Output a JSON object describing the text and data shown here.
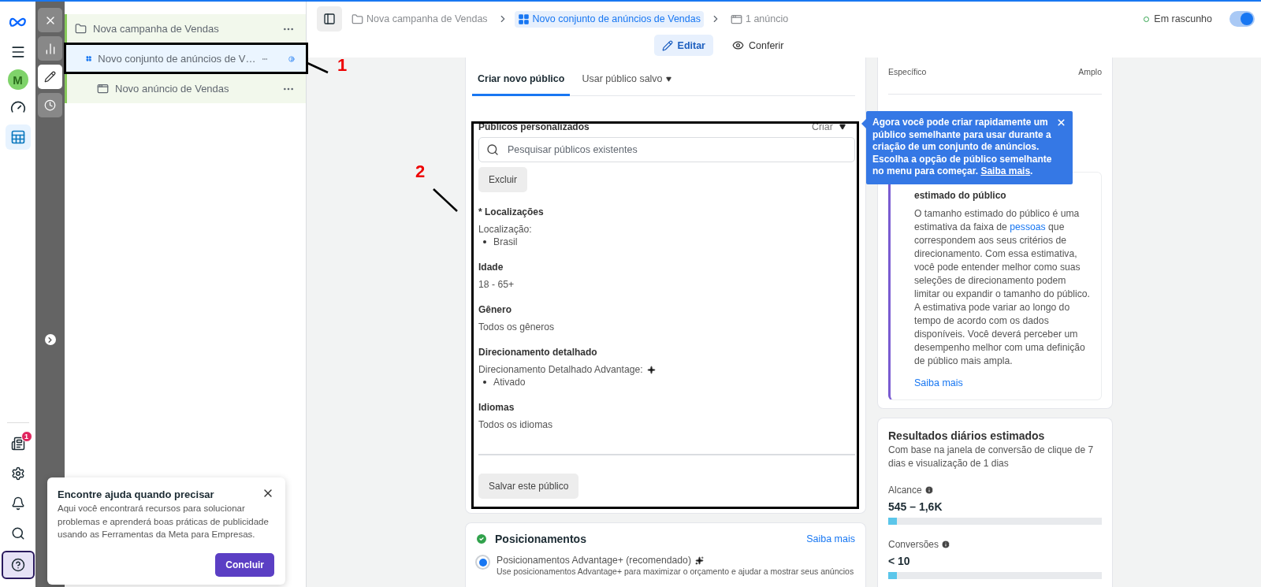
{
  "rail": {
    "avatar": "M",
    "items": [
      {
        "kind": "gauge",
        "selected": false
      },
      {
        "kind": "table",
        "selected": true
      }
    ],
    "notification_count": "1",
    "bottom": [
      {
        "kind": "news",
        "selected": false
      },
      {
        "kind": "settings",
        "selected": false
      },
      {
        "kind": "bell",
        "selected": false
      },
      {
        "kind": "search",
        "selected": false
      },
      {
        "kind": "help",
        "selected": true
      }
    ]
  },
  "tool_strip": [
    {
      "kind": "close",
      "selected": false
    },
    {
      "kind": "chart",
      "selected": false
    },
    {
      "kind": "edit",
      "selected": true
    },
    {
      "kind": "history",
      "selected": false
    }
  ],
  "tree": [
    {
      "kind": "campaign",
      "label": "Nova campanha de Vendas",
      "selected": false,
      "children": [
        {
          "kind": "adset",
          "label": "Novo conjunto de anúncios de V…",
          "selected": true,
          "children": [
            {
              "kind": "ad",
              "label": "Novo anúncio de Vendas",
              "selected": false
            }
          ]
        }
      ]
    }
  ],
  "help_popup": {
    "title": "Encontre ajuda quando precisar",
    "body": "Aqui você encontrará recursos para solucionar problemas e aprenderá boas práticas de publicidade usando as Ferramentas da Meta para Empresas.",
    "button": "Concluir"
  },
  "breadcrumbs": [
    {
      "kind": "campaign",
      "label": "Nova campanha de Vendas",
      "selected": false
    },
    {
      "kind": "adset",
      "label": "Novo conjunto de anúncios de Vendas",
      "selected": true
    },
    {
      "kind": "ad",
      "label": "1 anúncio",
      "selected": false
    }
  ],
  "status": {
    "label": "Em rascunho",
    "toggle_on": true
  },
  "view_tabs": [
    {
      "kind": "edit",
      "label": "Editar",
      "selected": true
    },
    {
      "kind": "review",
      "label": "Conferir",
      "selected": false
    }
  ],
  "audience_tabs": [
    {
      "label": "Criar novo público",
      "selected": true,
      "dropdown": false
    },
    {
      "label": "Usar público salvo",
      "selected": false,
      "dropdown": true
    }
  ],
  "custom_audiences": {
    "title": "Públicos personalizados",
    "create": "Criar",
    "search_placeholder": "Pesquisar públicos existentes",
    "exclude": "Excluir"
  },
  "sections": [
    {
      "title": "* Localizações",
      "lines": [
        {
          "kind": "text",
          "text": "Localização:"
        },
        {
          "kind": "bullet",
          "text": "Brasil"
        }
      ]
    },
    {
      "title": "Idade",
      "lines": [
        {
          "kind": "text",
          "text": "18 - 65+"
        }
      ]
    },
    {
      "title": "Gênero",
      "lines": [
        {
          "kind": "text",
          "text": "Todos os gêneros"
        }
      ]
    },
    {
      "title": "Direcionamento detalhado",
      "lines": [
        {
          "kind": "advantage",
          "text": "Direcionamento Detalhado Advantage:"
        },
        {
          "kind": "bullet",
          "text": "Ativado"
        }
      ]
    },
    {
      "title": "Idiomas",
      "lines": [
        {
          "kind": "text",
          "text": "Todos os idiomas"
        }
      ]
    }
  ],
  "save_button": "Salvar este público",
  "placements": {
    "title": "Posicionamentos",
    "complete": true,
    "link": "Saiba mais",
    "option": {
      "label": "Posicionamentos Advantage+ (recomendado)",
      "selected": true,
      "description": "Use posicionamentos Advantage+ para maximizar o orçamento e ajudar a mostrar seus anúncios"
    }
  },
  "audience_size": {
    "left": "Específico",
    "right": "Amplo",
    "info": {
      "title": "estimado do público",
      "body_before": "O tamanho estimado do público é uma estimativa da faixa de",
      "body_link": "pessoas",
      "body_after": "que correspondem aos seus critérios de direcionamento. Com essa estimativa, você pode entender melhor como suas seleções de direcionamento podem limitar ou expandir o tamanho do público. A estimativa pode variar ao longo do tempo de acordo com os dados disponíveis. Você deverá perceber um desempenho melhor com uma definição de público mais ampla.",
      "link": "Saiba mais"
    }
  },
  "daily_results": {
    "title": "Resultados diários estimados",
    "subtitle": "Com base na janela de conversão de clique de 7 dias e visualização de 1 dias",
    "metrics": [
      {
        "label": "Alcance",
        "value": "545 – 1,6K",
        "level": 0.04
      },
      {
        "label": "Conversões",
        "value": "< 10",
        "level": 0.04
      }
    ]
  },
  "tooltip": {
    "text": "Agora você pode criar rapidamente um público semelhante para usar durante a criação de um conjunto de anúncios. Escolha a opção de público semelhante no menu para começar.",
    "link": "Saiba mais",
    "tail": "."
  },
  "annotations": [
    {
      "label": "1"
    },
    {
      "label": "2"
    }
  ]
}
